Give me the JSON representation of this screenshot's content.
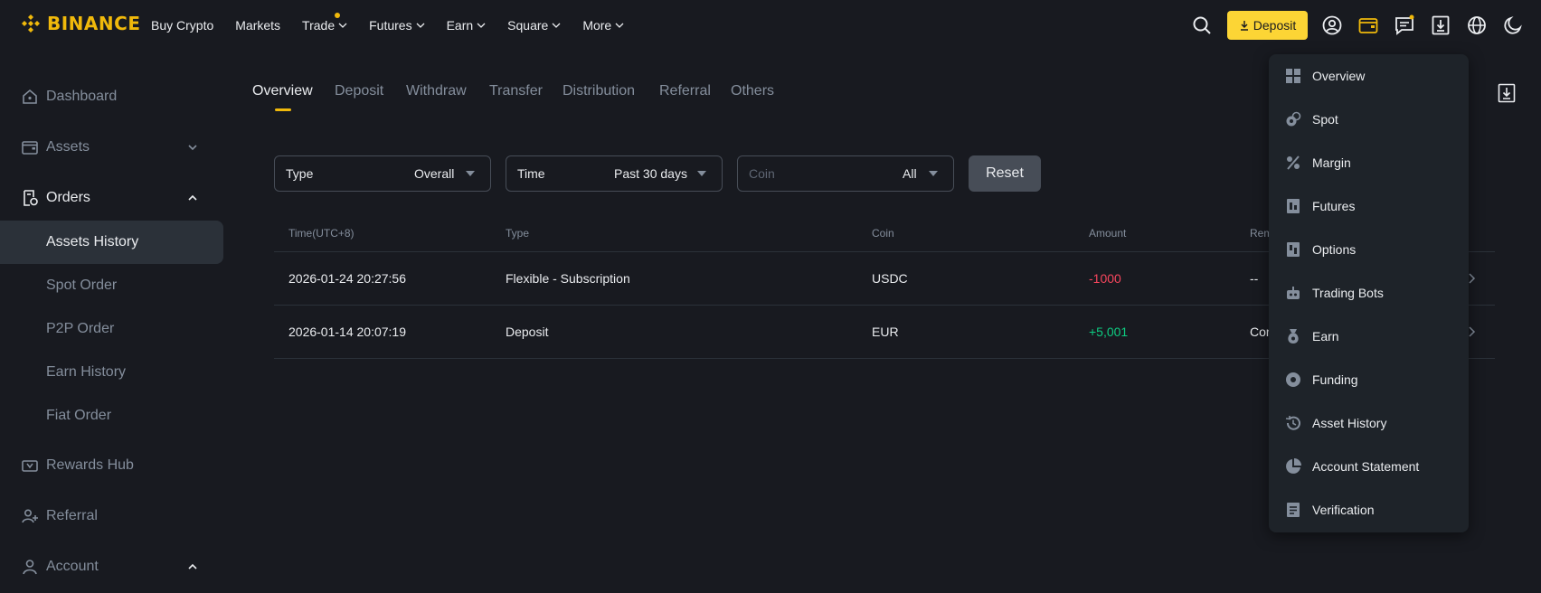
{
  "brand": {
    "name": "BINANCE",
    "color": "#f0b90b"
  },
  "nav": [
    {
      "label": "Buy Crypto",
      "chevron": false,
      "dot": false
    },
    {
      "label": "Markets",
      "chevron": false,
      "dot": false
    },
    {
      "label": "Trade",
      "chevron": true,
      "dot": true
    },
    {
      "label": "Futures",
      "chevron": true,
      "dot": false
    },
    {
      "label": "Earn",
      "chevron": true,
      "dot": false
    },
    {
      "label": "Square",
      "chevron": true,
      "dot": false
    },
    {
      "label": "More",
      "chevron": true,
      "dot": false
    }
  ],
  "header_actions": {
    "deposit_label": "Deposit",
    "icons": [
      "search-icon",
      "user-icon",
      "wallet-icon",
      "messages-icon",
      "download-icon",
      "globe-icon",
      "moon-icon"
    ]
  },
  "sidebar": {
    "dashboard": "Dashboard",
    "assets": "Assets",
    "orders": "Orders",
    "orders_sub": [
      "Assets History",
      "Spot Order",
      "P2P Order",
      "Earn History",
      "Fiat Order"
    ],
    "rewards_hub": "Rewards Hub",
    "referral": "Referral",
    "account": "Account"
  },
  "tabs": [
    "Overview",
    "Deposit",
    "Withdraw",
    "Transfer",
    "Distribution",
    "Referral",
    "Others"
  ],
  "filters": {
    "type": {
      "label": "Type",
      "value": "Overall"
    },
    "time": {
      "label": "Time",
      "value": "Past 30 days"
    },
    "coin": {
      "placeholder": "Coin",
      "value": "All"
    },
    "reset_label": "Reset"
  },
  "table": {
    "headers": [
      "Time(UTC+8)",
      "Type",
      "Coin",
      "Amount",
      "Rem"
    ],
    "rows": [
      {
        "time": "2026-01-24 20:27:56",
        "type": "Flexible - Subscription",
        "coin": "USDC",
        "amount": "-1000",
        "remark": "--"
      },
      {
        "time": "2026-01-14 20:07:19",
        "type": "Deposit",
        "coin": "EUR",
        "amount": "+5,001",
        "remark": "Cor"
      }
    ]
  },
  "wallet_menu": {
    "items": [
      {
        "label": "Overview",
        "icon": "grid-icon"
      },
      {
        "label": "Spot",
        "icon": "spot-icon"
      },
      {
        "label": "Margin",
        "icon": "margin-icon"
      },
      {
        "label": "Futures",
        "icon": "futures-icon"
      },
      {
        "label": "Options",
        "icon": "options-icon"
      },
      {
        "label": "Trading Bots",
        "icon": "robot-icon"
      },
      {
        "label": "Earn",
        "icon": "earn-icon"
      },
      {
        "label": "Funding",
        "icon": "funding-icon"
      },
      {
        "label": "Asset History",
        "icon": "history-icon"
      },
      {
        "label": "Account Statement",
        "icon": "statement-icon"
      },
      {
        "label": "Verification",
        "icon": "verification-icon"
      }
    ]
  },
  "colors": {
    "accent": "#fcd535",
    "negative": "#f6465d",
    "positive": "#0ecb81",
    "background": "#181a20",
    "panel": "#1e2329"
  }
}
